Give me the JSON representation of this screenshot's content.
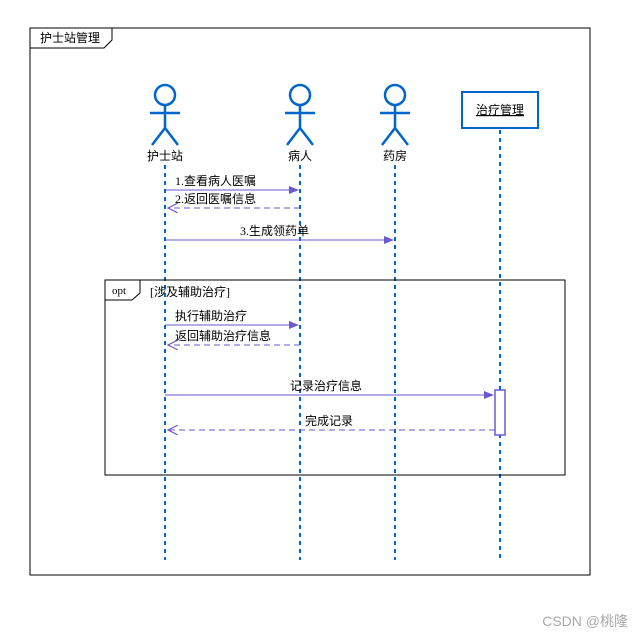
{
  "diagram": {
    "frame_title": "护士站管理",
    "participants": {
      "nurse": "护士站",
      "patient": "病人",
      "pharmacy": "药房",
      "mgmt": "治疗管理"
    },
    "messages": {
      "m1": "1.查看病人医嘱",
      "m2": "2.返回医嘱信息",
      "m3": "3.生成领药单",
      "m4": "执行辅助治疗",
      "m5": "返回辅助治疗信息",
      "m6": "记录治疗信息",
      "m7": "完成记录"
    },
    "opt": {
      "label": "opt",
      "guard": "[涉及辅助治疗]"
    }
  },
  "watermark": "CSDN @桃隆"
}
